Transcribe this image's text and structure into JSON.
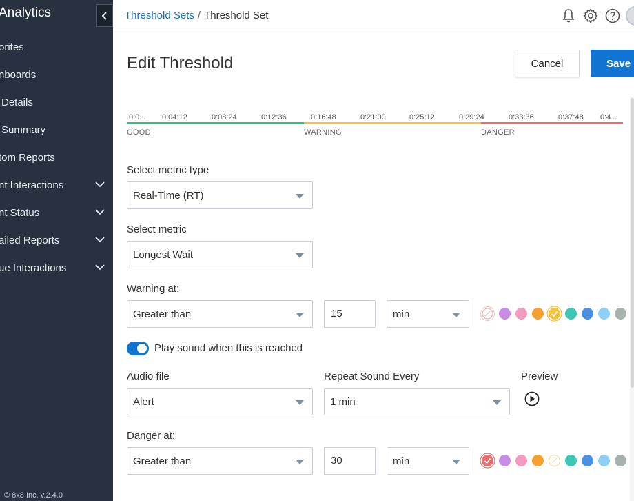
{
  "sidebar": {
    "app_title": "Analytics",
    "items": [
      {
        "label": "orites",
        "expandable": false
      },
      {
        "label": "nboards",
        "expandable": false
      },
      {
        "label": "Details",
        "expandable": false
      },
      {
        "label": "Summary",
        "expandable": false
      },
      {
        "label": "tom Reports",
        "expandable": false
      },
      {
        "label": "nt Interactions",
        "expandable": true
      },
      {
        "label": "nt Status",
        "expandable": true
      },
      {
        "label": "ailed Reports",
        "expandable": true
      },
      {
        "label": "ue Interactions",
        "expandable": true
      }
    ],
    "footer": "© 8x8 Inc. v.2.4.0"
  },
  "header": {
    "breadcrumb_parent": "Threshold Sets",
    "breadcrumb_separator": "/",
    "breadcrumb_current": "Threshold Set",
    "icons": [
      "bell-icon",
      "gear-icon",
      "help-icon"
    ]
  },
  "page": {
    "title": "Edit Threshold",
    "cancel_label": "Cancel",
    "save_label": "Save"
  },
  "timeline": {
    "ticks": [
      "0:0...",
      "0:04:12",
      "0:08:24",
      "0:12:36",
      "0:16:48",
      "0:21:00",
      "0:25:12",
      "0:29:24",
      "0:33:36",
      "0:37:48",
      "0:4..."
    ],
    "zones": [
      {
        "label": "GOOD",
        "color": "#2ec27e"
      },
      {
        "label": "WARNING",
        "color": "#f5c242"
      },
      {
        "label": "DANGER",
        "color": "#ef6a6a"
      }
    ]
  },
  "form": {
    "metric_type_label": "Select metric type",
    "metric_type_value": "Real-Time (RT)",
    "metric_label": "Select metric",
    "metric_value": "Longest Wait",
    "warning_label": "Warning at:",
    "warning_condition": "Greater than",
    "warning_value": "15",
    "warning_unit": "min",
    "sound_toggle_label": "Play sound when this is reached",
    "sound_enabled": true,
    "audio_file_label": "Audio file",
    "audio_file_value": "Alert",
    "repeat_label": "Repeat Sound Every",
    "repeat_value": "1 min",
    "preview_label": "Preview",
    "danger_label": "Danger at:",
    "danger_condition": "Greater than",
    "danger_value": "30",
    "danger_unit": "min"
  },
  "colors": {
    "swatches": [
      "none",
      "#c88be6",
      "#f49ac1",
      "#f5a030",
      "#f5c242",
      "#3cc7b4",
      "#4a90e2",
      "#8ed0f5",
      "#a7b2ad"
    ],
    "danger_swatches": [
      "#ef6a6a",
      "#c88be6",
      "#f49ac1",
      "#f5a030",
      "none",
      "#3cc7b4",
      "#4a90e2",
      "#8ed0f5",
      "#a7b2ad"
    ],
    "warning_selected": "#f5c242",
    "danger_selected": "#ef6a6a",
    "accent": "#1174d3",
    "sidebar_bg": "#27313f"
  }
}
